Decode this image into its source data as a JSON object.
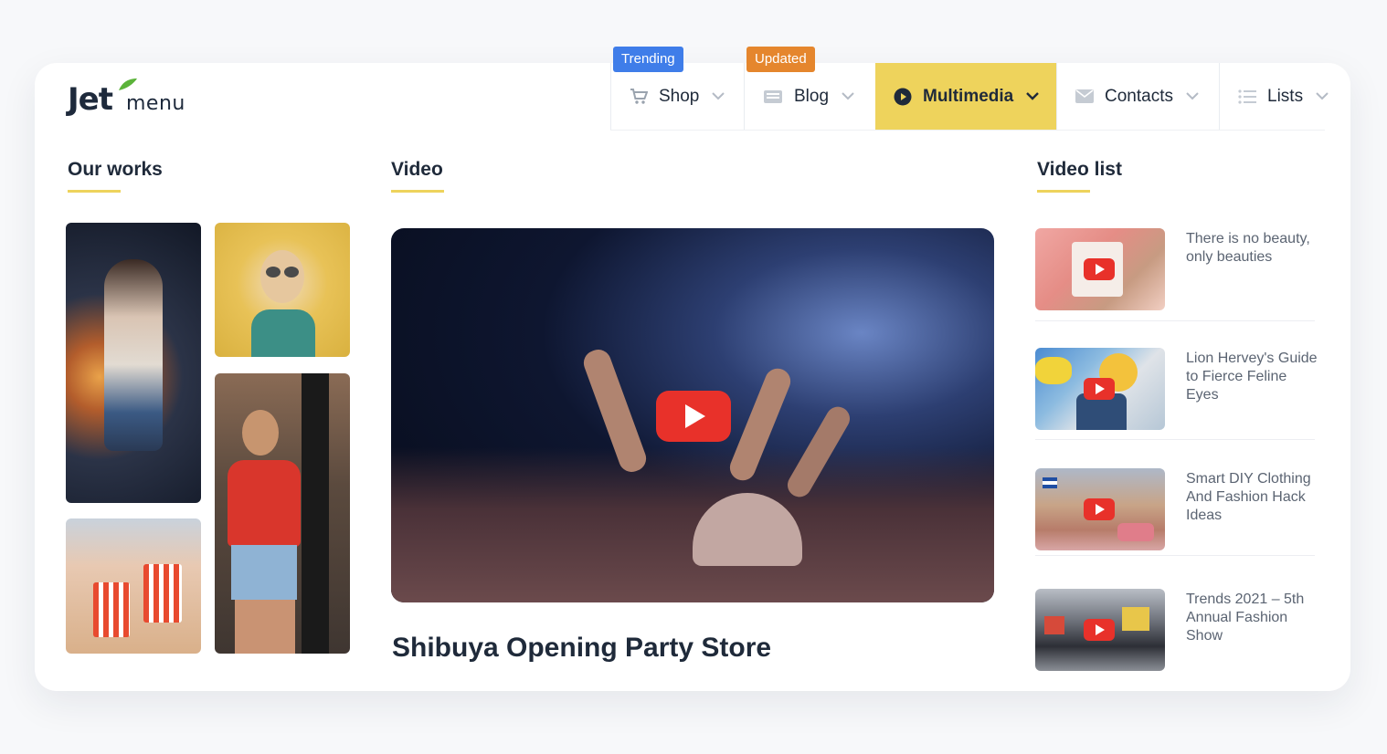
{
  "brand": {
    "logo_text": "JetMenu",
    "accent_color": "#eed35c"
  },
  "nav": {
    "items": [
      {
        "label": "Shop",
        "icon": "cart-icon",
        "badge": "Trending",
        "badge_color": "#3f7de9"
      },
      {
        "label": "Blog",
        "icon": "newspaper-icon",
        "badge": "Updated",
        "badge_color": "#e5862d"
      },
      {
        "label": "Multimedia",
        "icon": "play-circle-icon",
        "active": true
      },
      {
        "label": "Contacts",
        "icon": "envelope-icon"
      },
      {
        "label": "Lists",
        "icon": "list-icon"
      }
    ]
  },
  "sections": {
    "our_works": "Our works",
    "video": "Video",
    "video_list": "Video list"
  },
  "main_video": {
    "title": "Shibuya Opening Party Store"
  },
  "video_list": [
    {
      "title": "There is no beauty, only beauties"
    },
    {
      "title": "Lion Hervey's Guide to Fierce Feline Eyes"
    },
    {
      "title": "Smart DIY Clothing And Fashion Hack Ideas"
    },
    {
      "title": "Trends 2021 – 5th Annual Fashion Show"
    }
  ]
}
